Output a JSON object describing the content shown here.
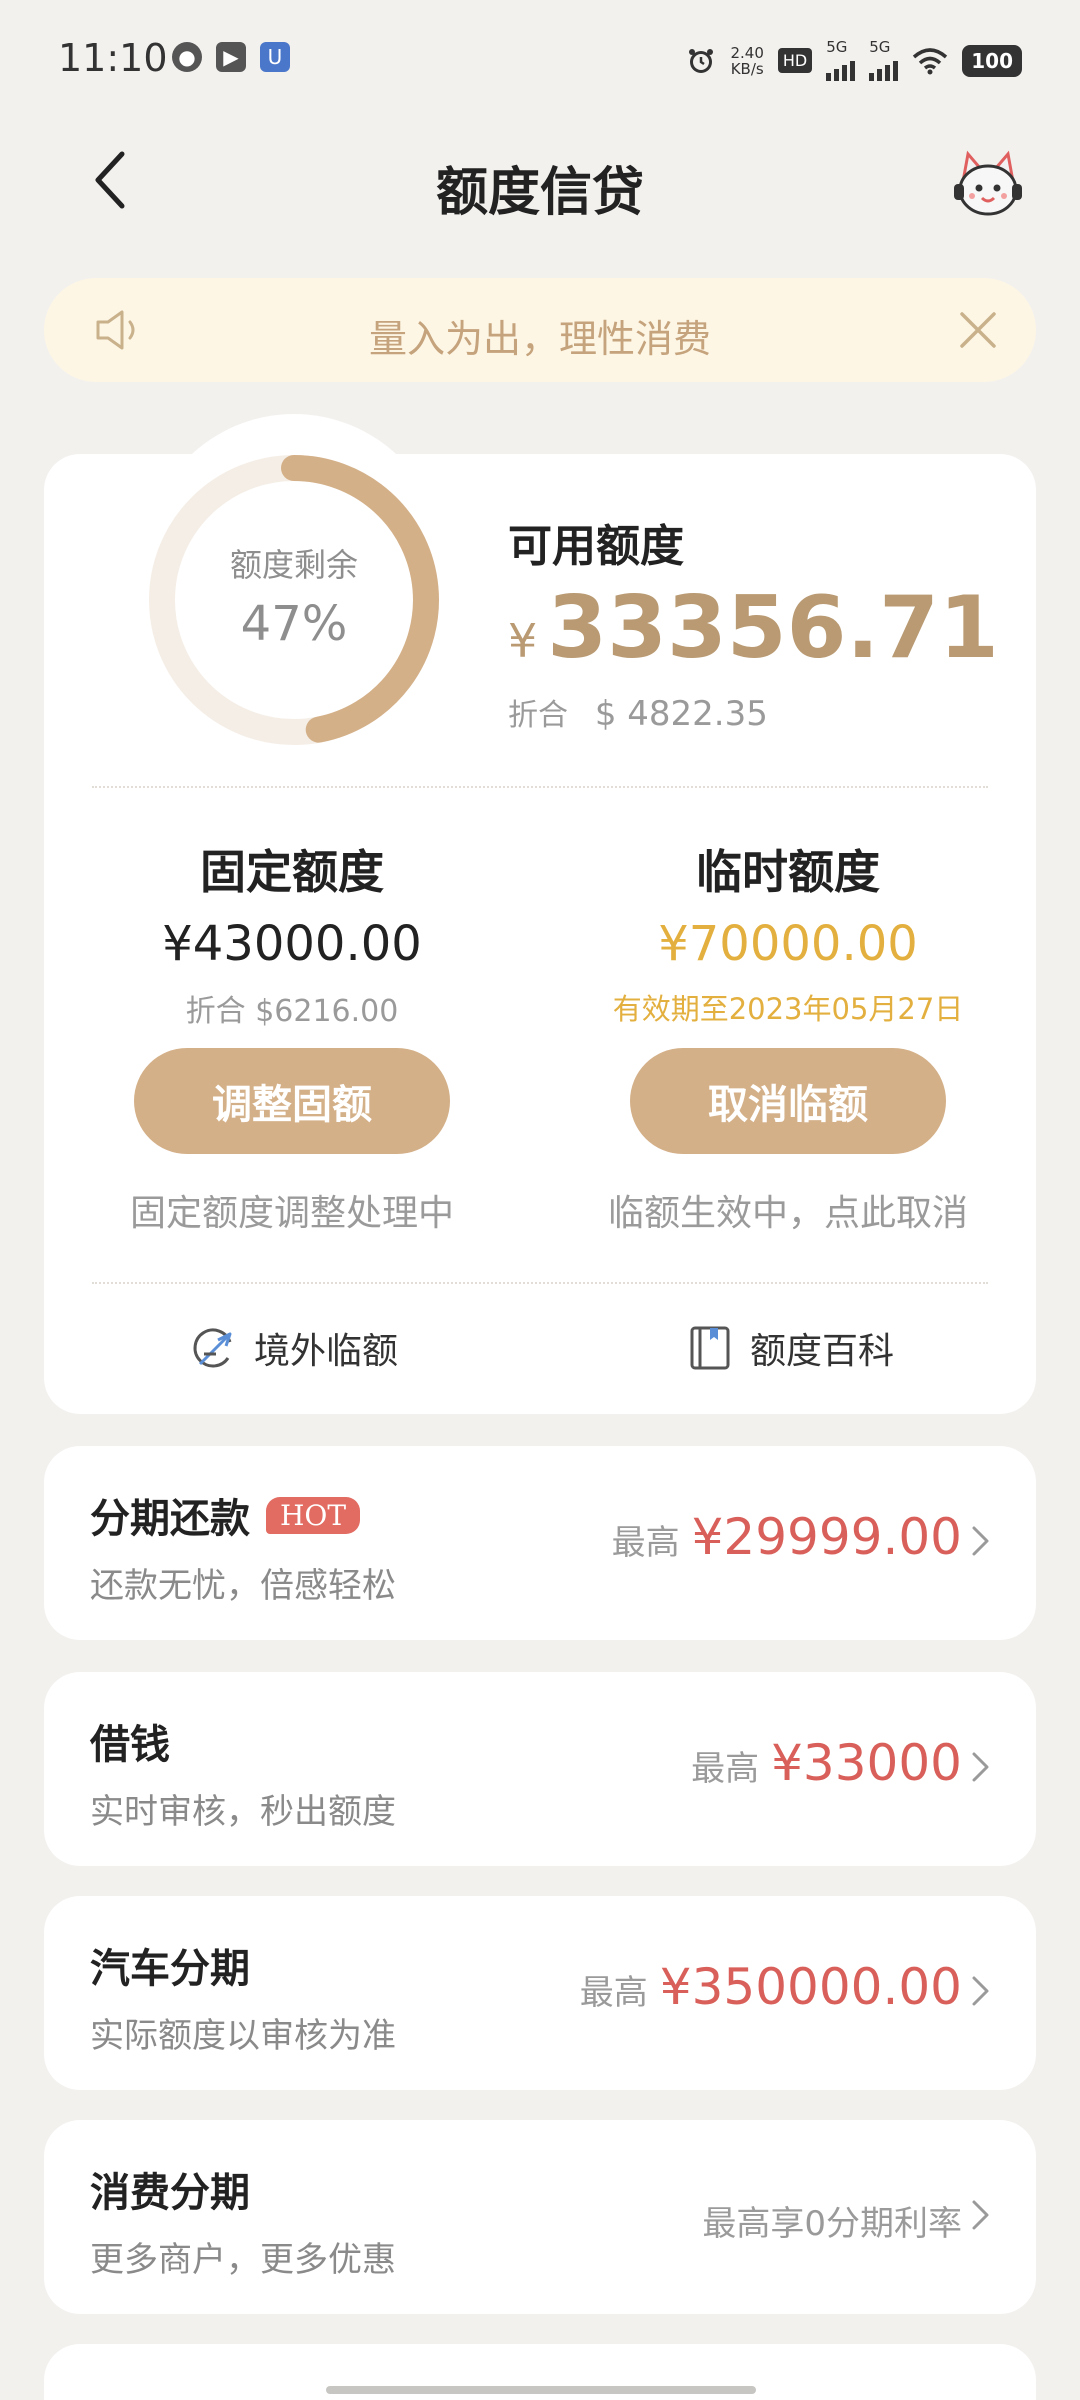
{
  "status_bar": {
    "time": "11:10",
    "net_speed_value": "2.40",
    "net_speed_unit": "KB/s",
    "hd_label": "HD",
    "sim1_label": "5G",
    "sim2_label": "5G",
    "battery": "100"
  },
  "header": {
    "title": "额度信贷"
  },
  "notice": {
    "text": "量入为出，理性消费"
  },
  "credit": {
    "ring_label": "额度剩余",
    "ring_percent_text": "47%",
    "ring_percent": 47,
    "available_label": "可用额度",
    "currency_symbol": "¥",
    "available_amount": "33356.71",
    "usd_label": "折合",
    "usd_amount": "$ 4822.35"
  },
  "fixed": {
    "title": "固定额度",
    "amount": "¥43000.00",
    "usd": "折合 $6216.00",
    "button": "调整固额",
    "note": "固定额度调整处理中"
  },
  "temporary": {
    "title": "临时额度",
    "amount": "¥70000.00",
    "validity": "有效期至2023年05月27日",
    "button": "取消临额",
    "note": "临额生效中，点此取消"
  },
  "links": {
    "overseas": "境外临额",
    "wiki": "额度百科"
  },
  "products": [
    {
      "title": "分期还款",
      "badge": "HOT",
      "subtitle": "还款无忧，倍感轻松",
      "prefix": "最高",
      "amount": "¥29999.00"
    },
    {
      "title": "借钱",
      "subtitle": "实时审核，秒出额度",
      "prefix": "最高",
      "amount": "¥33000"
    },
    {
      "title": "汽车分期",
      "subtitle": "实际额度以审核为准",
      "prefix": "最高",
      "amount": "¥350000.00"
    },
    {
      "title": "消费分期",
      "subtitle": "更多商户，更多优惠",
      "plain": "最高享0分期利率"
    }
  ],
  "colors": {
    "accent_gold": "#d4b088",
    "amount_gold": "#b99a72",
    "temp_gold": "#e3b03f",
    "amount_red": "#d9605a",
    "background": "#f3f1ee",
    "notice_bg": "#fdf6e5"
  }
}
